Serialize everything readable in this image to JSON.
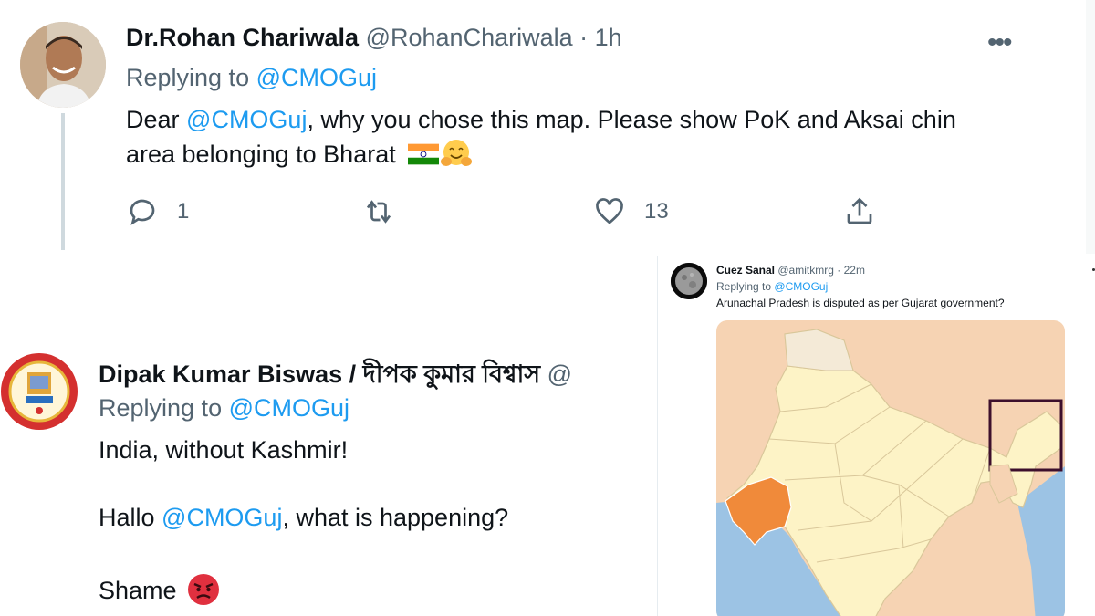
{
  "tweet1": {
    "display_name": "Dr.Rohan Chariwala",
    "handle": "@RohanChariwala",
    "separator": "·",
    "time": "1h",
    "replying_prefix": "Replying to",
    "replying_handle": "@CMOGuj",
    "text_part1": "Dear ",
    "text_mention": "@CMOGuj",
    "text_part2": ", why you chose this map. Please show PoK and Aksai chin",
    "text_line2": "area belonging to Bharat",
    "emojis": [
      "india-flag",
      "hugging-face"
    ],
    "more_label": "•••",
    "actions": {
      "reply_count": "1",
      "retweet_count": "",
      "like_count": "13"
    }
  },
  "tweet2": {
    "display_name": "Dipak Kumar Biswas / দীপক কুমার বিশ্বাস",
    "handle_fragment": "@",
    "replying_prefix": "Replying to",
    "replying_handle": "@CMOGuj",
    "line1": "India, without Kashmir!",
    "line2_prefix": "Hallo ",
    "line2_mention": "@CMOGuj",
    "line2_suffix": ", what is happening?",
    "line3": "Shame",
    "emoji": "angry-face"
  },
  "tweet3": {
    "display_name": "Cuez Sanal",
    "handle": "@amitkmrg",
    "separator": "·",
    "time": "22m",
    "replying_prefix": "Replying to",
    "replying_handle": "@CMOGuj",
    "text": "Arunachal Pradesh is disputed as per Gujarat government?",
    "map": {
      "highlighted_state": "Gujarat",
      "highlight_color": "#f08a3a",
      "boxed_region": "Arunachal Pradesh"
    }
  },
  "colors": {
    "link": "#1d9bf0",
    "muted": "#536471",
    "text": "#0f1419"
  }
}
